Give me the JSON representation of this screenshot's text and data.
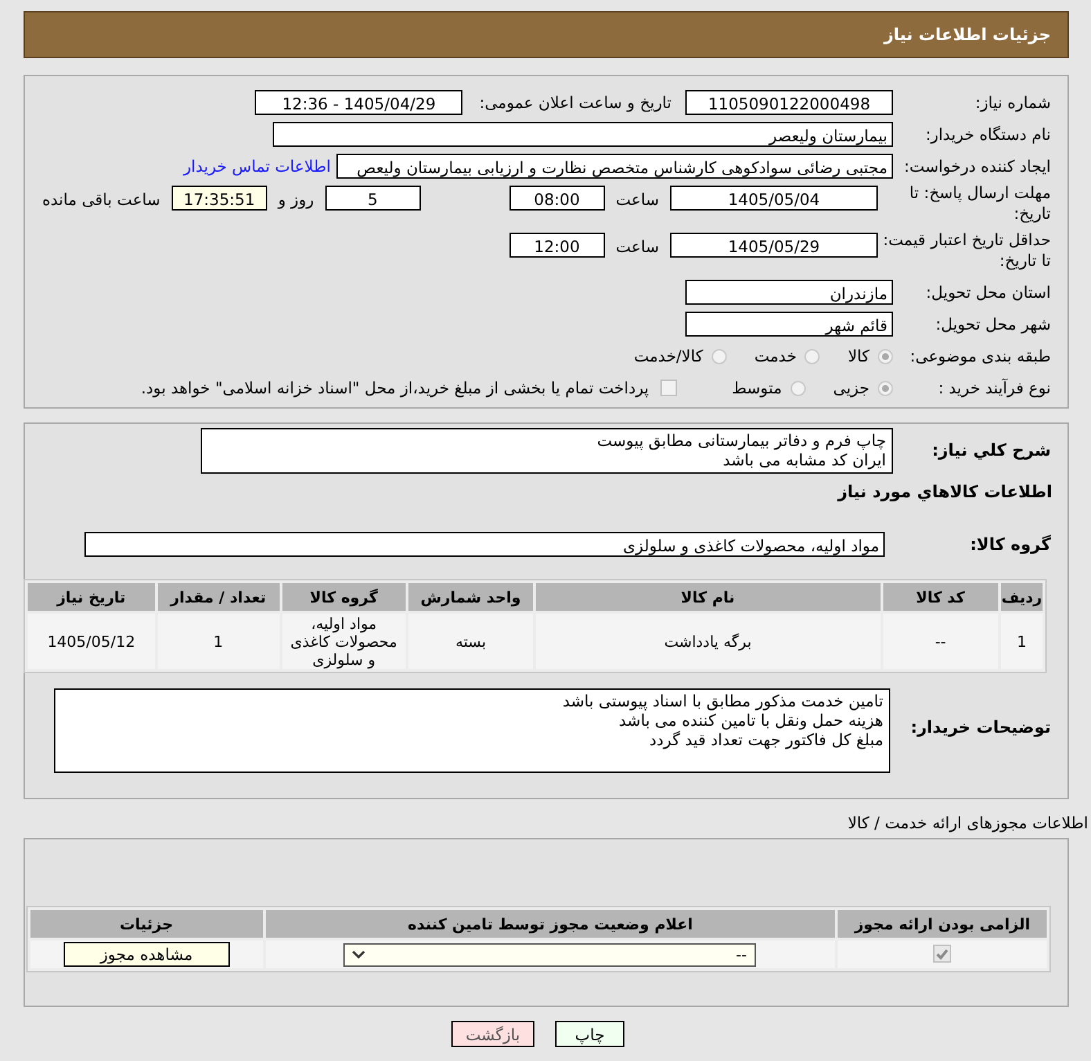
{
  "header": {
    "title": "جزئیات اطلاعات نیاز"
  },
  "need_number": {
    "label": "شماره نیاز:",
    "value": "1105090122000498"
  },
  "announce": {
    "label": "تاریخ و ساعت اعلان عمومی:",
    "value": "1405/04/29 - 12:36"
  },
  "buyer_org": {
    "label": "نام دستگاه خریدار:",
    "value": "بیمارستان ولیعصر"
  },
  "requester": {
    "label": "ایجاد کننده درخواست:",
    "value": "مجتبی رضائی سوادکوهی کارشناس متخصص نظارت و ارزیابی بیمارستان ولیعص",
    "link": "اطلاعات تماس خریدار"
  },
  "reply_deadline": {
    "label": "مهلت ارسال پاسخ: تا تاریخ:",
    "date": "1405/05/04",
    "time_label": "ساعت",
    "time": "08:00",
    "days": "5",
    "days_label": "روز و",
    "remaining": "17:35:51",
    "remaining_label": "ساعت باقی مانده"
  },
  "price_validity": {
    "label": "حداقل تاریخ اعتبار قیمت: تا تاریخ:",
    "date": "1405/05/29",
    "time_label": "ساعت",
    "time": "12:00"
  },
  "province": {
    "label": "استان محل تحویل:",
    "value": "مازندران"
  },
  "city": {
    "label": "شهر محل تحویل:",
    "value": "قائم شهر"
  },
  "category": {
    "label": "طبقه بندی موضوعی:",
    "options": [
      {
        "label": "کالا",
        "selected": true
      },
      {
        "label": "خدمت",
        "selected": false
      },
      {
        "label": "کالا/خدمت",
        "selected": false
      }
    ]
  },
  "process": {
    "label": "نوع فرآیند خرید :",
    "options": [
      {
        "label": "جزیی",
        "selected": true
      },
      {
        "label": "متوسط",
        "selected": false
      }
    ],
    "treasury": {
      "checked": false,
      "text": "پرداخت تمام یا بخشی از مبلغ خرید،از محل \"اسناد خزانه اسلامی\" خواهد بود."
    }
  },
  "description": {
    "label": "شرح کلي نياز:",
    "text": "چاپ فرم و دفاتر بیمارستانی مطابق پیوست\nایران کد مشابه می باشد"
  },
  "goods_heading": "اطلاعات کالاهاي مورد نياز",
  "goods_group": {
    "label": "گروه کالا:",
    "value": "مواد اولیه، محصولات کاغذی و سلولزی"
  },
  "goods_table": {
    "columns": [
      "ردیف",
      "کد کالا",
      "نام کالا",
      "واحد شمارش",
      "گروه کالا",
      "تعداد / مقدار",
      "تاریخ نیاز"
    ],
    "rows": [
      [
        "1",
        "--",
        "برگه یادداشت",
        "بسته",
        "مواد اولیه، محصولات کاغذی و سلولزی",
        "1",
        "1405/05/12"
      ]
    ]
  },
  "buyer_notes": {
    "label": "توضیحات خریدار:",
    "text": "تامین خدمت مذکور مطابق با اسناد پیوستی باشد\nهزینه حمل ونقل با تامین کننده می باشد\nمبلغ کل  فاکتور جهت تعداد قید گردد"
  },
  "permits_heading": "اطلاعات مجوزهای ارائه خدمت / کالا",
  "permits_table": {
    "columns": [
      "الزامی بودن ارائه مجوز",
      "اعلام وضعیت مجوز توسط تامین کننده",
      "جزئیات"
    ],
    "rows": [
      {
        "required": true,
        "status": "--",
        "details_button": "مشاهده مجوز"
      }
    ]
  },
  "buttons": [
    {
      "label": "چاپ",
      "kind": "print"
    },
    {
      "label": "بازگشت",
      "kind": "back"
    }
  ]
}
